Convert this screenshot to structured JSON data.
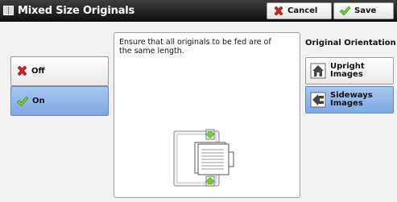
{
  "header": {
    "title": "Mixed Size Originals",
    "cancel_label": "Cancel",
    "save_label": "Save"
  },
  "options": {
    "off_label": "Off",
    "on_label": "On",
    "selected": "On"
  },
  "message": "Ensure that all originals to be fed are of the same length.",
  "orientation": {
    "heading": "Original Orientation",
    "upright_label": "Upright Images",
    "sideways_label": "Sideways\nImages",
    "selected": "Sideways Images"
  },
  "icons": {
    "cancel": "red-x-icon",
    "save": "green-check-icon",
    "off": "red-x-icon",
    "on": "green-check-icon",
    "upright": "upright-house-icon",
    "sideways": "sideways-house-icon"
  },
  "colors": {
    "titlebar": "#1a1a1a",
    "selected": "#8fb4e8",
    "cancel_icon": "#d42020",
    "check_icon": "#7cc73a"
  }
}
